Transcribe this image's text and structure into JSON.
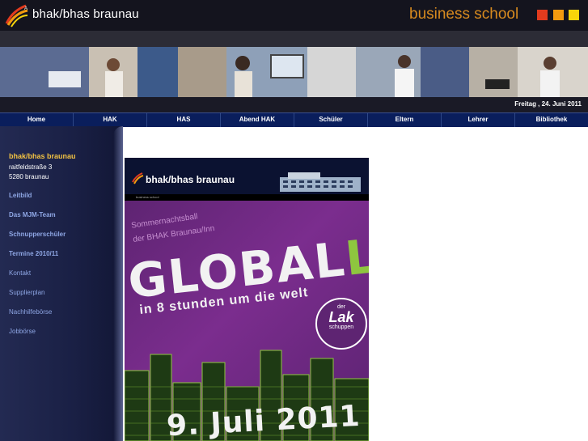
{
  "header": {
    "brand": "bhak/bhas braunau",
    "tagline": "business school",
    "squares": [
      "#e23b1e",
      "#f29a0f",
      "#f7d40a"
    ]
  },
  "date": "Freitag , 24. Juni 2011",
  "nav": [
    "Home",
    "HAK",
    "HAS",
    "Abend HAK",
    "Schüler",
    "Eltern",
    "Lehrer",
    "Bibliothek"
  ],
  "sidebar": {
    "school_name": "bhak/bhas braunau",
    "address_line1": "raitfeldstraße 3",
    "address_line2": "5280 braunau",
    "links": [
      {
        "label": "Leitbild",
        "bold": true
      },
      {
        "label": "Das MJM-Team",
        "bold": true
      },
      {
        "label": "Schnupperschüler",
        "bold": true
      },
      {
        "label": "Termine 2010/11",
        "bold": true
      },
      {
        "label": "Kontakt",
        "bold": false
      },
      {
        "label": "Supplierplan",
        "bold": false
      },
      {
        "label": "Nachhilfebörse",
        "bold": false
      },
      {
        "label": "Jobbörse",
        "bold": false
      }
    ]
  },
  "poster": {
    "brand": "bhak/bhas braunau",
    "subbrand": "business school",
    "line1": "Sommernachtsball",
    "line2": "der BHAK Braunau/Inn",
    "title_main": "GLOBAL",
    "title_l": "L",
    "slogan": "in 8 stunden um die welt",
    "badge_der": "der",
    "badge_lak": "Lak",
    "badge_sch": "schuppen",
    "date": "9. Juli 2011"
  },
  "colors": {
    "accent": "#d78a1f",
    "sidebar_bold": "#f1c243",
    "sidebar_link": "#8ea6e4",
    "nav_bg": "#0a1e5c",
    "poster_purple": "#7b2d8e",
    "poster_green": "#8ec63f"
  }
}
